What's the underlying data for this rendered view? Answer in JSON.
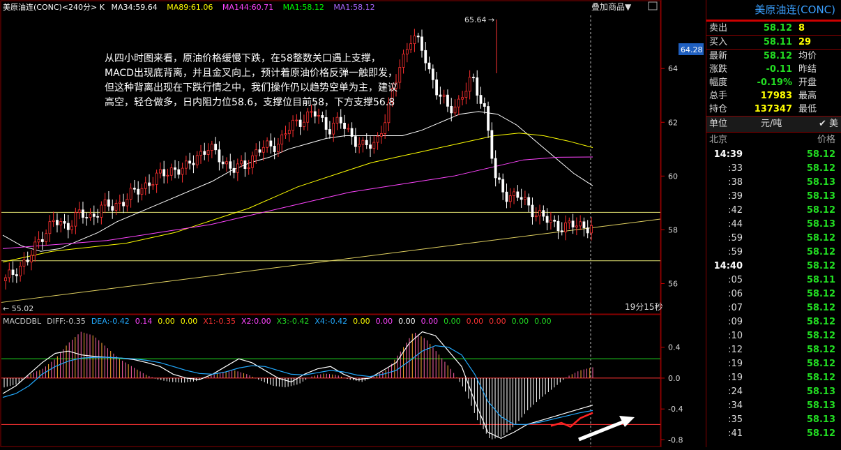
{
  "header": {
    "symbol_line": "美原油连(CONC)<240分> K",
    "ma34": "MA34:59.64",
    "ma89": "MA89:61.06",
    "ma144": "MA144:60.71",
    "ma1a": "MA1:58.12",
    "ma1b": "MA1:58.12",
    "add_product": "叠加商品▼",
    "colors": {
      "ma34": "#ffffff",
      "ma89": "#ffff00",
      "ma144": "#ff44ff",
      "ma1a": "#00ff00",
      "ma1b": "#aa66ff",
      "symbol": "#ffffff"
    }
  },
  "annotation": {
    "lines": [
      "从四小时图来看，原油价格缓慢下跌，在58整数关口遇上支撑，",
      "MACD出现底背离，并且金叉向上，预计着原油价格反弹一触即发，",
      "但这种背离出现在下跌行情之中，我们操作仍以趋势空单为主，建议",
      "高空，轻仓做多，日内阻力位58.6，支撑位目前58，下方支撑56.8"
    ]
  },
  "price_axis": {
    "ticks": [
      "64",
      "62",
      "60",
      "58",
      "56"
    ],
    "current_tag": "64.28",
    "high_label": "65.64",
    "low_label": "← 55.02",
    "countdown": "19分15秒"
  },
  "macd_header": {
    "items": [
      {
        "text": "MACDDBL",
        "color": "#cccccc"
      },
      {
        "text": "DIFF:-0.35",
        "color": "#cccccc"
      },
      {
        "text": "DEA:-0.42",
        "color": "#22aaff"
      },
      {
        "text": "0.14",
        "color": "#ff44ff"
      },
      {
        "text": "0.00",
        "color": "#ffff00"
      },
      {
        "text": "0.00",
        "color": "#ffff00"
      },
      {
        "text": "X1:-0.35",
        "color": "#ff3333"
      },
      {
        "text": "X2:0.00",
        "color": "#ff44ff"
      },
      {
        "text": "X3:-0.42",
        "color": "#22dd22"
      },
      {
        "text": "X4:-0.42",
        "color": "#22aaff"
      },
      {
        "text": "0.00",
        "color": "#ffff00"
      },
      {
        "text": "0.00",
        "color": "#ff44ff"
      },
      {
        "text": "0.00",
        "color": "#ffffff"
      },
      {
        "text": "0.00",
        "color": "#ff44ff"
      },
      {
        "text": "0.00",
        "color": "#22dd22"
      },
      {
        "text": "0.00",
        "color": "#ff3333"
      },
      {
        "text": "0.00",
        "color": "#ff3333"
      },
      {
        "text": "0.00",
        "color": "#22dd22"
      },
      {
        "text": "0.00",
        "color": "#22dd22"
      }
    ]
  },
  "macd_axis": {
    "ticks": [
      "0.4",
      "0.0",
      "-0.4",
      "-0.8"
    ]
  },
  "chart_data": [
    {
      "type": "candlestick",
      "title": "美原油连(CONC)<240分> K",
      "ylim": [
        55,
        65.9
      ],
      "support_resistance": [
        58.65,
        56.85
      ],
      "trendline": {
        "from": [
          0,
          55.3
        ],
        "to": [
          1,
          58.4
        ]
      },
      "close_path": [
        56.1,
        56.6,
        56.9,
        57.8,
        58.3,
        58.1,
        58.6,
        58.4,
        58.9,
        58.8,
        59.2,
        59.4,
        59.8,
        60.0,
        60.3,
        60.2,
        60.8,
        61.0,
        60.7,
        60.2,
        60.4,
        60.9,
        61.1,
        61.3,
        61.9,
        62.2,
        62.3,
        61.8,
        62.0,
        61.5,
        61.0,
        61.3,
        62.4,
        64.2,
        65.2,
        64.6,
        63.2,
        62.5,
        62.8,
        63.6,
        62.7,
        59.8,
        59.3,
        59.2,
        58.8,
        58.4,
        58.2,
        58.1,
        58.2,
        58.12
      ],
      "ma_lines": [
        {
          "name": "MA34",
          "color": "#ffffff",
          "values": [
            57.8,
            57.4,
            57.2,
            57.3,
            57.6,
            57.9,
            58.3,
            58.6,
            58.9,
            59.2,
            59.5,
            59.8,
            60.2,
            60.5,
            60.7,
            61.0,
            61.2,
            61.4,
            61.5,
            61.5,
            61.5,
            61.5,
            61.7,
            62.0,
            62.3,
            62.4,
            62.3,
            61.9,
            61.3,
            60.7,
            60.1,
            59.64
          ]
        },
        {
          "name": "MA89",
          "color": "#ffff00",
          "values": [
            56.8,
            57.0,
            57.2,
            57.3,
            57.4,
            57.5,
            57.7,
            57.9,
            58.2,
            58.5,
            58.8,
            59.2,
            59.6,
            59.9,
            60.2,
            60.5,
            60.7,
            60.9,
            61.1,
            61.3,
            61.5,
            61.6,
            61.5,
            61.3,
            61.06
          ]
        },
        {
          "name": "MA144",
          "color": "#ff44ff",
          "values": [
            57.3,
            57.4,
            57.5,
            57.6,
            57.8,
            58.0,
            58.2,
            58.5,
            58.8,
            59.1,
            59.4,
            59.6,
            59.8,
            60.0,
            60.3,
            60.6,
            60.7,
            60.71
          ]
        }
      ]
    },
    {
      "type": "bar",
      "title": "MACDDBL",
      "ylim": [
        -0.85,
        0.65
      ],
      "histogram": [
        -0.12,
        -0.08,
        0.05,
        0.12,
        0.25,
        0.45,
        0.6,
        0.55,
        0.4,
        0.25,
        0.15,
        0.05,
        -0.02,
        -0.05,
        -0.06,
        -0.04,
        0.02,
        0.08,
        0.1,
        0.05,
        -0.03,
        -0.1,
        -0.12,
        -0.08,
        0.02,
        0.06,
        0.04,
        -0.02,
        -0.05,
        0.03,
        0.12,
        0.35,
        0.6,
        0.5,
        0.3,
        0.1,
        -0.15,
        -0.55,
        -0.8,
        -0.75,
        -0.6,
        -0.4,
        -0.25,
        -0.12,
        0.02,
        0.1,
        0.14
      ],
      "series": [
        {
          "name": "DIFF",
          "color": "#ffffff",
          "values": [
            -0.2,
            -0.1,
            0.05,
            0.2,
            0.32,
            0.35,
            0.3,
            0.28,
            0.27,
            0.26,
            0.24,
            0.2,
            0.15,
            0.05,
            0.0,
            -0.02,
            0.05,
            0.15,
            0.25,
            0.2,
            0.1,
            0.0,
            -0.05,
            0.05,
            0.12,
            0.15,
            0.05,
            -0.02,
            0.0,
            0.1,
            0.2,
            0.45,
            0.6,
            0.55,
            0.35,
            0.15,
            -0.3,
            -0.7,
            -0.78,
            -0.7,
            -0.6,
            -0.55,
            -0.5,
            -0.45,
            -0.4,
            -0.35
          ]
        },
        {
          "name": "DEA",
          "color": "#22aaff",
          "values": [
            -0.25,
            -0.2,
            -0.1,
            0.05,
            0.15,
            0.22,
            0.26,
            0.27,
            0.27,
            0.26,
            0.25,
            0.23,
            0.2,
            0.15,
            0.1,
            0.06,
            0.05,
            0.08,
            0.13,
            0.16,
            0.15,
            0.1,
            0.05,
            0.04,
            0.07,
            0.1,
            0.08,
            0.04,
            0.02,
            0.05,
            0.1,
            0.22,
            0.35,
            0.42,
            0.4,
            0.3,
            0.05,
            -0.3,
            -0.5,
            -0.6,
            -0.6,
            -0.57,
            -0.53,
            -0.49,
            -0.45,
            -0.42
          ]
        }
      ]
    }
  ],
  "right_panel": {
    "title": "美原油连(CONC)",
    "ask_label": "卖出",
    "ask_price": "58.12",
    "ask_size": "8",
    "bid_label": "买入",
    "bid_price": "58.11",
    "bid_size": "29",
    "latest_label": "最新",
    "latest": "58.12",
    "avg_label": "均价",
    "change_label": "涨跌",
    "change": "-0.11",
    "prev_label": "昨结",
    "pct_label": "幅度",
    "pct": "-0.19%",
    "open_label": "开盘",
    "volume_label": "总手",
    "volume": "17983",
    "high_label": "最高",
    "oi_label": "持仓",
    "oi": "137347",
    "low_label": "最低",
    "unit_label": "单位",
    "unit_value": "元/吨",
    "unit_extra": "✔ 美",
    "tick_head_left": "北京",
    "tick_head_right": "价格",
    "ticks": [
      {
        "t": "14:39",
        "p": "58.12",
        "major": true
      },
      {
        "t": ":33",
        "p": "58.12"
      },
      {
        "t": ":38",
        "p": "58.13"
      },
      {
        "t": ":39",
        "p": "58.13"
      },
      {
        "t": ":42",
        "p": "58.12"
      },
      {
        "t": ":44",
        "p": "58.13"
      },
      {
        "t": ":59",
        "p": "58.12"
      },
      {
        "t": ":59",
        "p": "58.12"
      },
      {
        "t": "14:40",
        "p": "58.12",
        "major": true
      },
      {
        "t": ":05",
        "p": "58.11"
      },
      {
        "t": ":06",
        "p": "58.12"
      },
      {
        "t": ":07",
        "p": "58.12"
      },
      {
        "t": ":09",
        "p": "58.12"
      },
      {
        "t": ":10",
        "p": "58.12"
      },
      {
        "t": ":12",
        "p": "58.12"
      },
      {
        "t": ":19",
        "p": "58.12"
      },
      {
        "t": ":19",
        "p": "58.12"
      },
      {
        "t": ":24",
        "p": "58.13"
      },
      {
        "t": ":34",
        "p": "58.13"
      },
      {
        "t": ":35",
        "p": "58.13"
      },
      {
        "t": ":41",
        "p": "58.12"
      }
    ]
  }
}
